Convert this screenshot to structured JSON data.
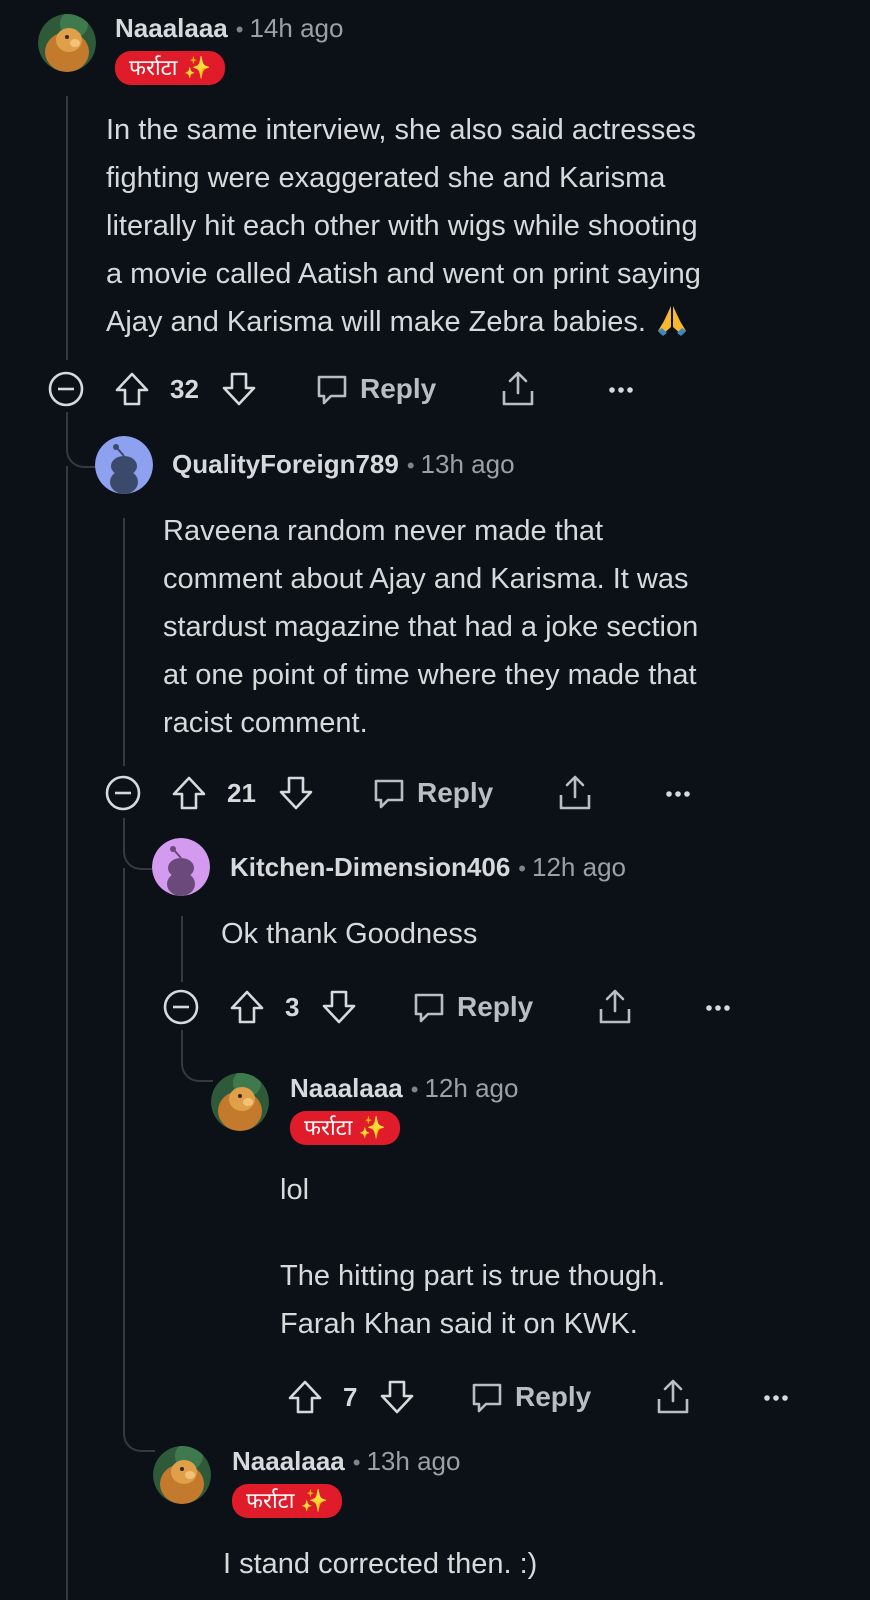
{
  "comments": [
    {
      "username": "Naaalaaa",
      "time": "14h ago",
      "flair": "फर्राटा ✨",
      "body": [
        "In the same interview, she also said actresses",
        "fighting were exaggerated she and Karisma",
        "literally hit each other with wigs while shooting",
        "a movie called Aatish and went on print saying",
        "Ajay and Karisma will make Zebra babies."
      ],
      "votes": "32",
      "reply_label": "Reply",
      "avatar_icon": "lion-avatar-icon"
    },
    {
      "username": "QualityForeign789",
      "time": "13h ago",
      "body": [
        "Raveena random never made that",
        "comment about Ajay and Karisma. It was",
        "stardust magazine that had a joke section",
        "at one point of time where they made that",
        "racist comment."
      ],
      "votes": "21",
      "reply_label": "Reply",
      "avatar_icon": "snoo-avatar-icon",
      "avatar_color": "#8ea0f0"
    },
    {
      "username": "Kitchen-Dimension406",
      "time": "12h ago",
      "body": [
        "Ok thank Goodness"
      ],
      "votes": "3",
      "reply_label": "Reply",
      "avatar_icon": "snoo-avatar-icon",
      "avatar_color": "#d49af0"
    },
    {
      "username": "Naaalaaa",
      "time": "12h ago",
      "flair": "फर्राटा ✨",
      "body": [
        "lol",
        "",
        "The hitting part is true though.",
        "Farah Khan said it on KWK."
      ],
      "votes": "7",
      "reply_label": "Reply",
      "avatar_icon": "lion-avatar-icon"
    },
    {
      "username": "Naaalaaa",
      "time": "13h ago",
      "flair": "फर्राटा ✨",
      "body": [
        "I stand corrected then. :)"
      ],
      "avatar_icon": "lion-avatar-icon"
    }
  ],
  "colors": {
    "background": "#0b1116",
    "flair": "#e01b2a",
    "thread_line": "#343a40"
  }
}
